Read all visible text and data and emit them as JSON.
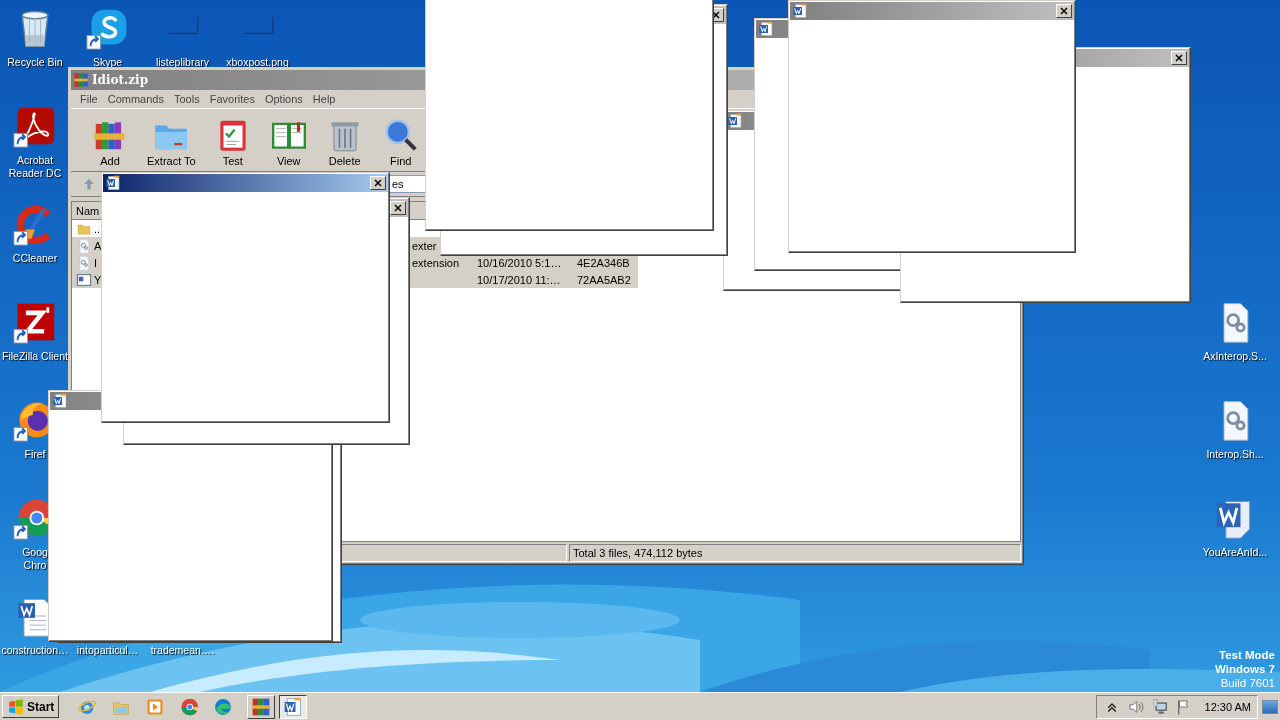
{
  "desktop": {
    "left_column": [
      {
        "label": "Recycle Bin",
        "kind": "recycle_bin",
        "shortcut": false
      },
      {
        "label": "Acrobat Reader DC",
        "kind": "acrobat",
        "shortcut": true
      },
      {
        "label": "CCleaner",
        "kind": "ccleaner",
        "shortcut": true
      },
      {
        "label": "FileZilla Client",
        "kind": "filezilla",
        "shortcut": true
      },
      {
        "label": "Firef",
        "kind": "firefox",
        "shortcut": true
      },
      {
        "label": "Goog\nChro",
        "kind": "chrome",
        "shortcut": true
      },
      {
        "label": "construction…",
        "kind": "word_doc",
        "shortcut": false
      }
    ],
    "top_row": [
      {
        "label": "Skype",
        "kind": "skype",
        "shortcut": true
      },
      {
        "label": "listeplibrary",
        "kind": "thumbnail",
        "shortcut": false
      },
      {
        "label": "xboxpost.png",
        "kind": "thumbnail",
        "shortcut": false
      }
    ],
    "bottom_row": [
      {
        "label": "intoparticul…"
      },
      {
        "label": "trademean…."
      }
    ],
    "right_column": [
      {
        "label": "AxInterop.S...",
        "kind": "config_file",
        "shortcut": false
      },
      {
        "label": "Interop.Sh...",
        "kind": "config_file",
        "shortcut": false
      },
      {
        "label": "YouAreAnId...",
        "kind": "word",
        "shortcut": false
      }
    ],
    "os_notice": [
      {
        "text": "Test Mode",
        "bold": true
      },
      {
        "text": "Windows 7",
        "bold": true
      },
      {
        "text": "Build 7601",
        "bold": false
      }
    ]
  },
  "archive_window": {
    "title": "Idiot.zip",
    "active": false,
    "menu": [
      "File",
      "Commands",
      "Tools",
      "Favorites",
      "Options",
      "Help"
    ],
    "toolbar": [
      {
        "label": "Add",
        "kind": "add"
      },
      {
        "label": "Extract To",
        "kind": "extract"
      },
      {
        "label": "Test",
        "kind": "test"
      },
      {
        "label": "View",
        "kind": "view"
      },
      {
        "label": "Delete",
        "kind": "delete"
      },
      {
        "label": "Find",
        "kind": "find"
      }
    ],
    "address": "es",
    "column_header": "Nam",
    "files": [
      {
        "name": "..",
        "kind": "folder",
        "selected": false
      },
      {
        "name": "A",
        "kind": "config_file",
        "type": "exter",
        "selected": true
      },
      {
        "name": "I",
        "kind": "config_file",
        "type": "extension",
        "modified": "10/16/2010 5:1…",
        "crc": "4E2A346B",
        "selected": true
      },
      {
        "name": "Y",
        "kind": "doc",
        "modified": "10/17/2010 11:…",
        "crc": "72AA5AB2",
        "selected": true
      }
    ],
    "status": "Total 3 files, 474,112 bytes"
  },
  "popups": [
    {
      "kind": "icon_title",
      "active": false
    },
    {
      "kind": "icon_title",
      "active": false
    },
    {
      "kind": "titled",
      "active": false
    },
    {
      "kind": "titled",
      "active": false
    },
    {
      "kind": "titled",
      "active": false
    },
    {
      "kind": "plain"
    },
    {
      "kind": "plain"
    },
    {
      "kind": "titled",
      "active": false
    },
    {
      "kind": "titled",
      "active": false
    },
    {
      "kind": "titled",
      "active": true
    }
  ],
  "taskbar": {
    "start": "Start",
    "quick_launch": [
      {
        "kind": "ie"
      },
      {
        "kind": "explorer"
      },
      {
        "kind": "media_player"
      },
      {
        "kind": "chrome"
      },
      {
        "kind": "edge"
      }
    ],
    "tasks": [
      {
        "kind": "winrar",
        "selected": false
      },
      {
        "kind": "word",
        "selected": true
      }
    ],
    "tray": [
      {
        "kind": "chevron"
      },
      {
        "kind": "speaker"
      },
      {
        "kind": "network"
      },
      {
        "kind": "flag"
      }
    ],
    "clock": "12:30 AM"
  }
}
